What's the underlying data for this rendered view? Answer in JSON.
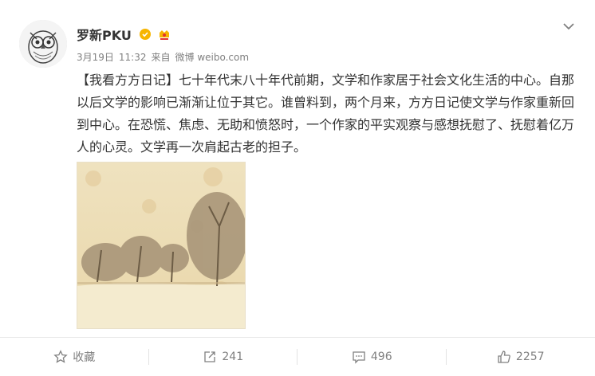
{
  "post": {
    "user": {
      "name": "罗新PKU"
    },
    "meta": {
      "date": "3月19日",
      "time": "11:32",
      "source_prefix": "来自",
      "source": "微博 weibo.com"
    },
    "content": "【我看方方日记】七十年代末八十年代前期，文学和作家居于社会文化生活的中心。自那以后文学的影响已渐渐让位于其它。谁曾料到，两个月来，方方日记使文学与作家重新回到中心。在恐慌、焦虑、无助和愤怒时，一个作家的平实观察与感想抚慰了、抚慰着亿万人的心灵。文学再一次肩起古老的担子。"
  },
  "toolbar": {
    "favorite_label": "收藏",
    "repost_count": "241",
    "comment_count": "496",
    "like_count": "2257"
  },
  "colors": {
    "verified": "#f7b500",
    "text": "#333333",
    "muted": "#808080"
  },
  "icons": {
    "verified": "verified-icon",
    "member_badge": "vip-badge-icon",
    "menu": "chevron-down-icon",
    "favorite": "star-icon",
    "repost": "repost-icon",
    "comment": "comment-icon",
    "like": "like-icon"
  }
}
